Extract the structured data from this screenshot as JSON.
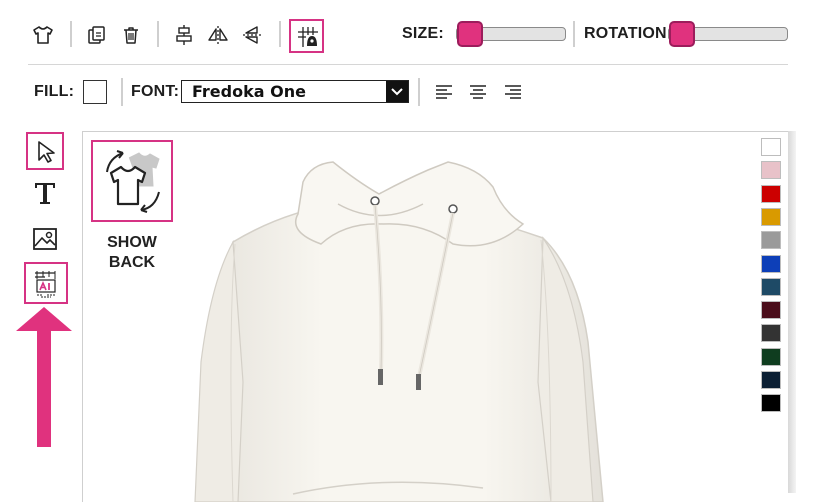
{
  "toolbar": {
    "size_label": "SIZE:",
    "rotation_label": "ROTATION:",
    "size_value": 0.0,
    "rotation_value": 0.0
  },
  "format_bar": {
    "fill_label": "FILL:",
    "font_label": "FONT:",
    "font_value": "Fredoka One"
  },
  "canvas": {
    "show_back_label": "SHOW BACK",
    "product": "hoodie"
  },
  "colors": {
    "accent": "#e0327e",
    "accent_border": "#d63384",
    "swatches": [
      "#ffffff",
      "#e8c2c9",
      "#cc0000",
      "#d99a00",
      "#9a9a9a",
      "#0d3fb8",
      "#1e4a66",
      "#4a0d1a",
      "#333333",
      "#0f3d1f",
      "#0c1f33",
      "#000000"
    ]
  }
}
